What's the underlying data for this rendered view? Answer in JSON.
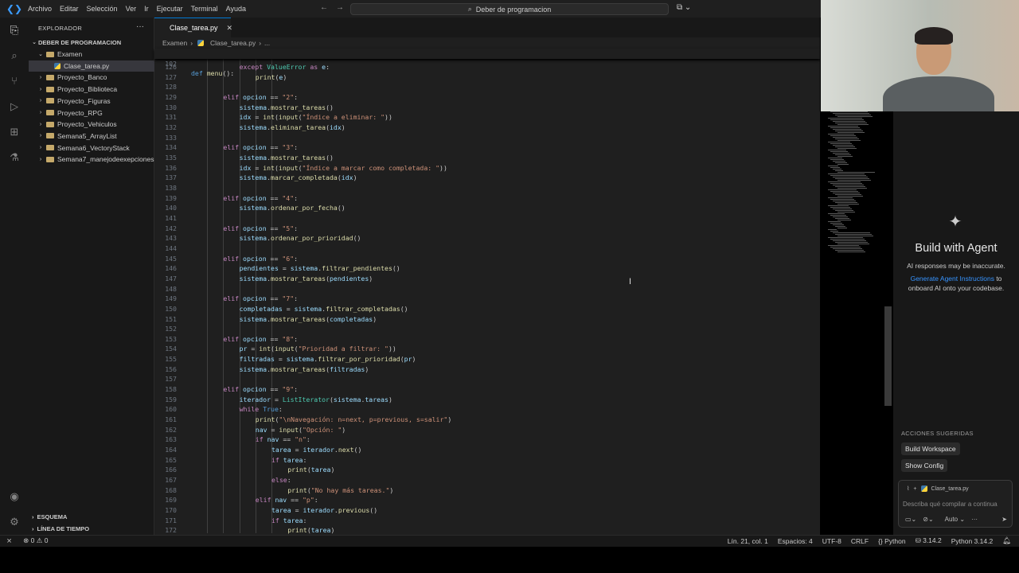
{
  "menu": [
    "Archivo",
    "Editar",
    "Selección",
    "Ver",
    "Ir",
    "Ejecutar",
    "Terminal",
    "Ayuda"
  ],
  "search_placeholder": "Deber de programacion",
  "explorer": {
    "title": "EXPLORADOR",
    "root": "DEBER DE PROGRAMACION",
    "items": [
      {
        "label": "Examen",
        "type": "folder-open",
        "indent": 1
      },
      {
        "label": "Clase_tarea.py",
        "type": "file",
        "indent": 2
      },
      {
        "label": "Proyecto_Banco",
        "type": "folder",
        "indent": 1
      },
      {
        "label": "Proyecto_Biblioteca",
        "type": "folder",
        "indent": 1
      },
      {
        "label": "Proyecto_Figuras",
        "type": "folder",
        "indent": 1
      },
      {
        "label": "Proyecto_RPG",
        "type": "folder",
        "indent": 1
      },
      {
        "label": "Proyecto_Vehiculos",
        "type": "folder",
        "indent": 1
      },
      {
        "label": "Semana5_ArrayList",
        "type": "folder",
        "indent": 1
      },
      {
        "label": "Semana6_VectoryStack",
        "type": "folder",
        "indent": 1
      },
      {
        "label": "Semana7_manejodeexepciones",
        "type": "folder",
        "indent": 1
      }
    ],
    "outline": "ESQUEMA",
    "timeline": "LÍNEA DE TIEMPO"
  },
  "tab": {
    "label": "Clase_tarea.py"
  },
  "breadcrumb": {
    "folder": "Examen",
    "file": "Clase_tarea.py",
    "more": "..."
  },
  "sticky": {
    "line": "102",
    "code": "def menu():"
  },
  "code_lines": [
    {
      "n": "126",
      "indent": 12,
      "t": "except ValueError as e:"
    },
    {
      "n": "127",
      "indent": 16,
      "t": "print(e)"
    },
    {
      "n": "128",
      "indent": 0,
      "t": ""
    },
    {
      "n": "129",
      "indent": 8,
      "t": "elif opcion == \"2\":"
    },
    {
      "n": "130",
      "indent": 12,
      "t": "sistema.mostrar_tareas()"
    },
    {
      "n": "131",
      "indent": 12,
      "t": "idx = int(input(\"Índice a eliminar: \"))"
    },
    {
      "n": "132",
      "indent": 12,
      "t": "sistema.eliminar_tarea(idx)"
    },
    {
      "n": "133",
      "indent": 0,
      "t": ""
    },
    {
      "n": "134",
      "indent": 8,
      "t": "elif opcion == \"3\":"
    },
    {
      "n": "135",
      "indent": 12,
      "t": "sistema.mostrar_tareas()"
    },
    {
      "n": "136",
      "indent": 12,
      "t": "idx = int(input(\"Índice a marcar como completada: \"))"
    },
    {
      "n": "137",
      "indent": 12,
      "t": "sistema.marcar_completada(idx)"
    },
    {
      "n": "138",
      "indent": 0,
      "t": ""
    },
    {
      "n": "139",
      "indent": 8,
      "t": "elif opcion == \"4\":"
    },
    {
      "n": "140",
      "indent": 12,
      "t": "sistema.ordenar_por_fecha()"
    },
    {
      "n": "141",
      "indent": 0,
      "t": ""
    },
    {
      "n": "142",
      "indent": 8,
      "t": "elif opcion == \"5\":"
    },
    {
      "n": "143",
      "indent": 12,
      "t": "sistema.ordenar_por_prioridad()"
    },
    {
      "n": "144",
      "indent": 0,
      "t": ""
    },
    {
      "n": "145",
      "indent": 8,
      "t": "elif opcion == \"6\":"
    },
    {
      "n": "146",
      "indent": 12,
      "t": "pendientes = sistema.filtrar_pendientes()"
    },
    {
      "n": "147",
      "indent": 12,
      "t": "sistema.mostrar_tareas(pendientes)"
    },
    {
      "n": "148",
      "indent": 0,
      "t": ""
    },
    {
      "n": "149",
      "indent": 8,
      "t": "elif opcion == \"7\":"
    },
    {
      "n": "150",
      "indent": 12,
      "t": "completadas = sistema.filtrar_completadas()"
    },
    {
      "n": "151",
      "indent": 12,
      "t": "sistema.mostrar_tareas(completadas)"
    },
    {
      "n": "152",
      "indent": 0,
      "t": ""
    },
    {
      "n": "153",
      "indent": 8,
      "t": "elif opcion == \"8\":"
    },
    {
      "n": "154",
      "indent": 12,
      "t": "pr = int(input(\"Prioridad a filtrar: \"))"
    },
    {
      "n": "155",
      "indent": 12,
      "t": "filtradas = sistema.filtrar_por_prioridad(pr)"
    },
    {
      "n": "156",
      "indent": 12,
      "t": "sistema.mostrar_tareas(filtradas)"
    },
    {
      "n": "157",
      "indent": 0,
      "t": ""
    },
    {
      "n": "158",
      "indent": 8,
      "t": "elif opcion == \"9\":"
    },
    {
      "n": "159",
      "indent": 12,
      "t": "iterador = ListIterator(sistema.tareas)"
    },
    {
      "n": "160",
      "indent": 12,
      "t": "while True:"
    },
    {
      "n": "161",
      "indent": 16,
      "t": "print(\"\\nNavegación: n=next, p=previous, s=salir\")"
    },
    {
      "n": "162",
      "indent": 16,
      "t": "nav = input(\"Opción: \")"
    },
    {
      "n": "163",
      "indent": 16,
      "t": "if nav == \"n\":"
    },
    {
      "n": "164",
      "indent": 20,
      "t": "tarea = iterador.next()"
    },
    {
      "n": "165",
      "indent": 20,
      "t": "if tarea:"
    },
    {
      "n": "166",
      "indent": 24,
      "t": "print(tarea)"
    },
    {
      "n": "167",
      "indent": 20,
      "t": "else:"
    },
    {
      "n": "168",
      "indent": 24,
      "t": "print(\"No hay más tareas.\")"
    },
    {
      "n": "169",
      "indent": 16,
      "t": "elif nav == \"p\":"
    },
    {
      "n": "170",
      "indent": 20,
      "t": "tarea = iterador.previous()"
    },
    {
      "n": "171",
      "indent": 20,
      "t": "if tarea:"
    },
    {
      "n": "172",
      "indent": 24,
      "t": "print(tarea)"
    }
  ],
  "chat": {
    "title": "Build with Agent",
    "disclaimer": "AI responses may be inaccurate.",
    "link": "Generate Agent Instructions",
    "link_suffix": " to onboard AI onto your codebase.",
    "suggested_title": "ACCIONES SUGERIDAS",
    "suggested": [
      "Build Workspace",
      "Show Config"
    ],
    "input_file": "Clase_tarea.py",
    "input_placeholder": "Describa qué compilar a continua",
    "mode": "Auto"
  },
  "status": {
    "errors": "0",
    "warnings": "0",
    "position": "Lín. 21, col. 1",
    "spaces": "Espacios: 4",
    "encoding": "UTF-8",
    "eol": "CRLF",
    "language": "Python",
    "version": "3.14.2",
    "interpreter": "Python 3.14.2"
  },
  "colors": {
    "accent": "#0078d4",
    "link": "#3794ff",
    "editor_bg": "#1f1f1f",
    "sidebar_bg": "#181818"
  }
}
